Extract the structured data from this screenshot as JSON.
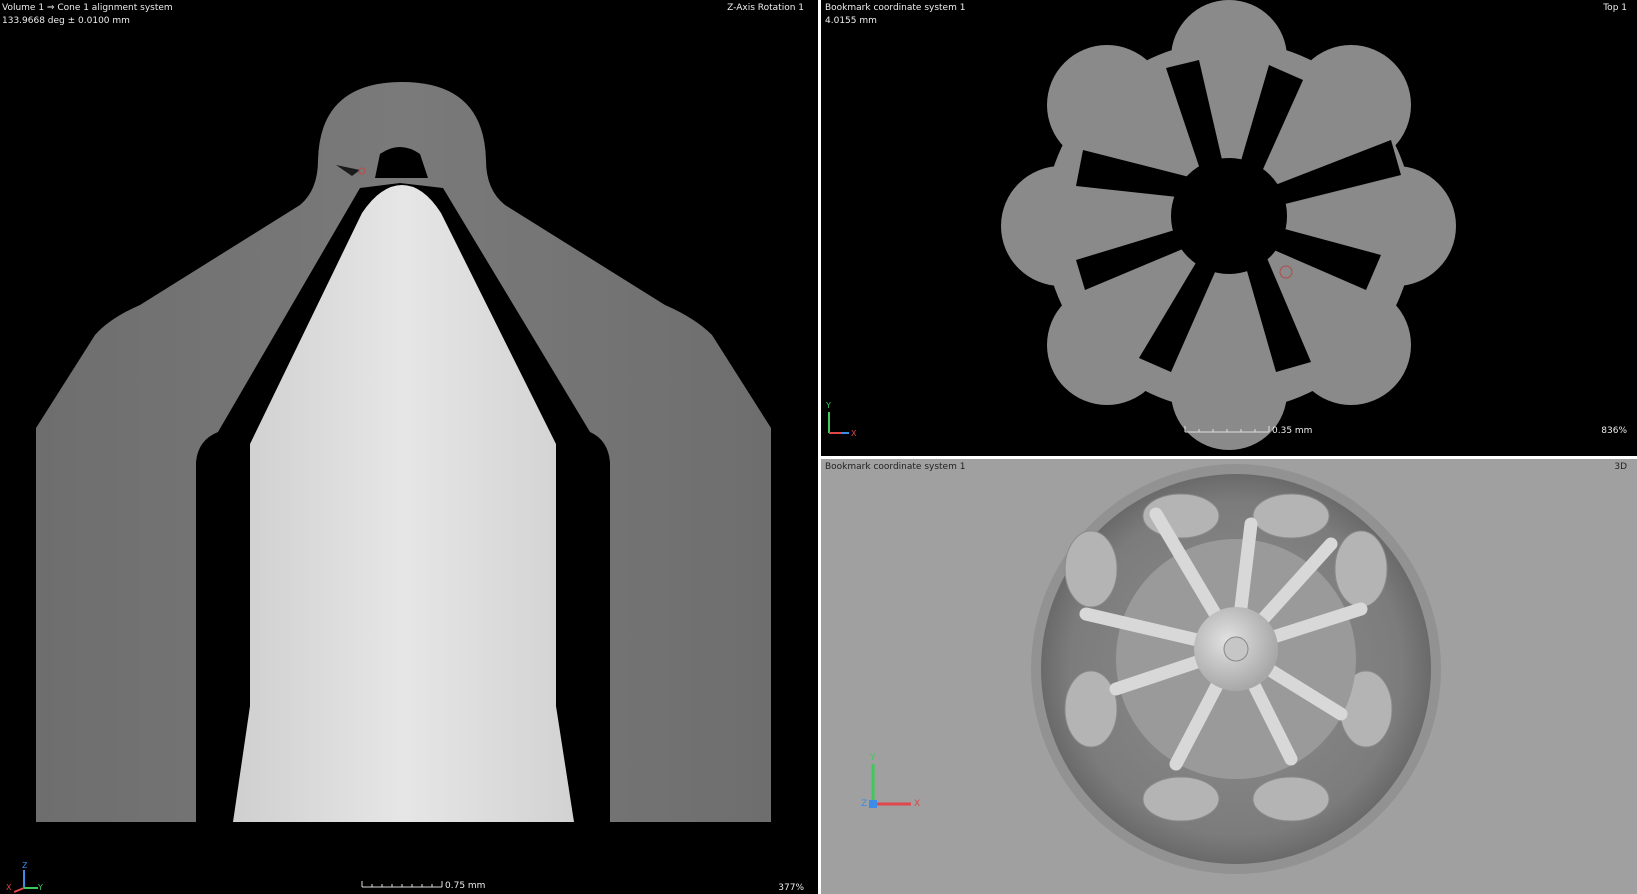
{
  "left_view": {
    "title": "Volume 1 ⇒ Cone 1 alignment system",
    "subtitle": "133.9668 deg ± 0.0100 mm",
    "view_name": "Z-Axis Rotation 1",
    "scale_label": "0.75 mm",
    "zoom": "377%",
    "axes": {
      "a": "Z",
      "b": "Y",
      "c": "X"
    }
  },
  "top_right_view": {
    "title": "Bookmark coordinate system 1",
    "subtitle": "4.0155 mm",
    "view_name": "Top 1",
    "scale_label": "0.35 mm",
    "zoom": "836%",
    "axes": {
      "a": "Y",
      "b": "X"
    }
  },
  "bottom_right_view": {
    "title": "Bookmark coordinate system 1",
    "view_name": "3D",
    "axes": {
      "a": "Y",
      "b": "X",
      "c": "Z"
    }
  },
  "colors": {
    "axis_x": "#e0464a",
    "axis_y": "#3ccb5a",
    "axis_z": "#3c8ce8",
    "background": "#000000",
    "gray_material": "#6f6f6f",
    "bright_material": "#dcdcdc"
  }
}
